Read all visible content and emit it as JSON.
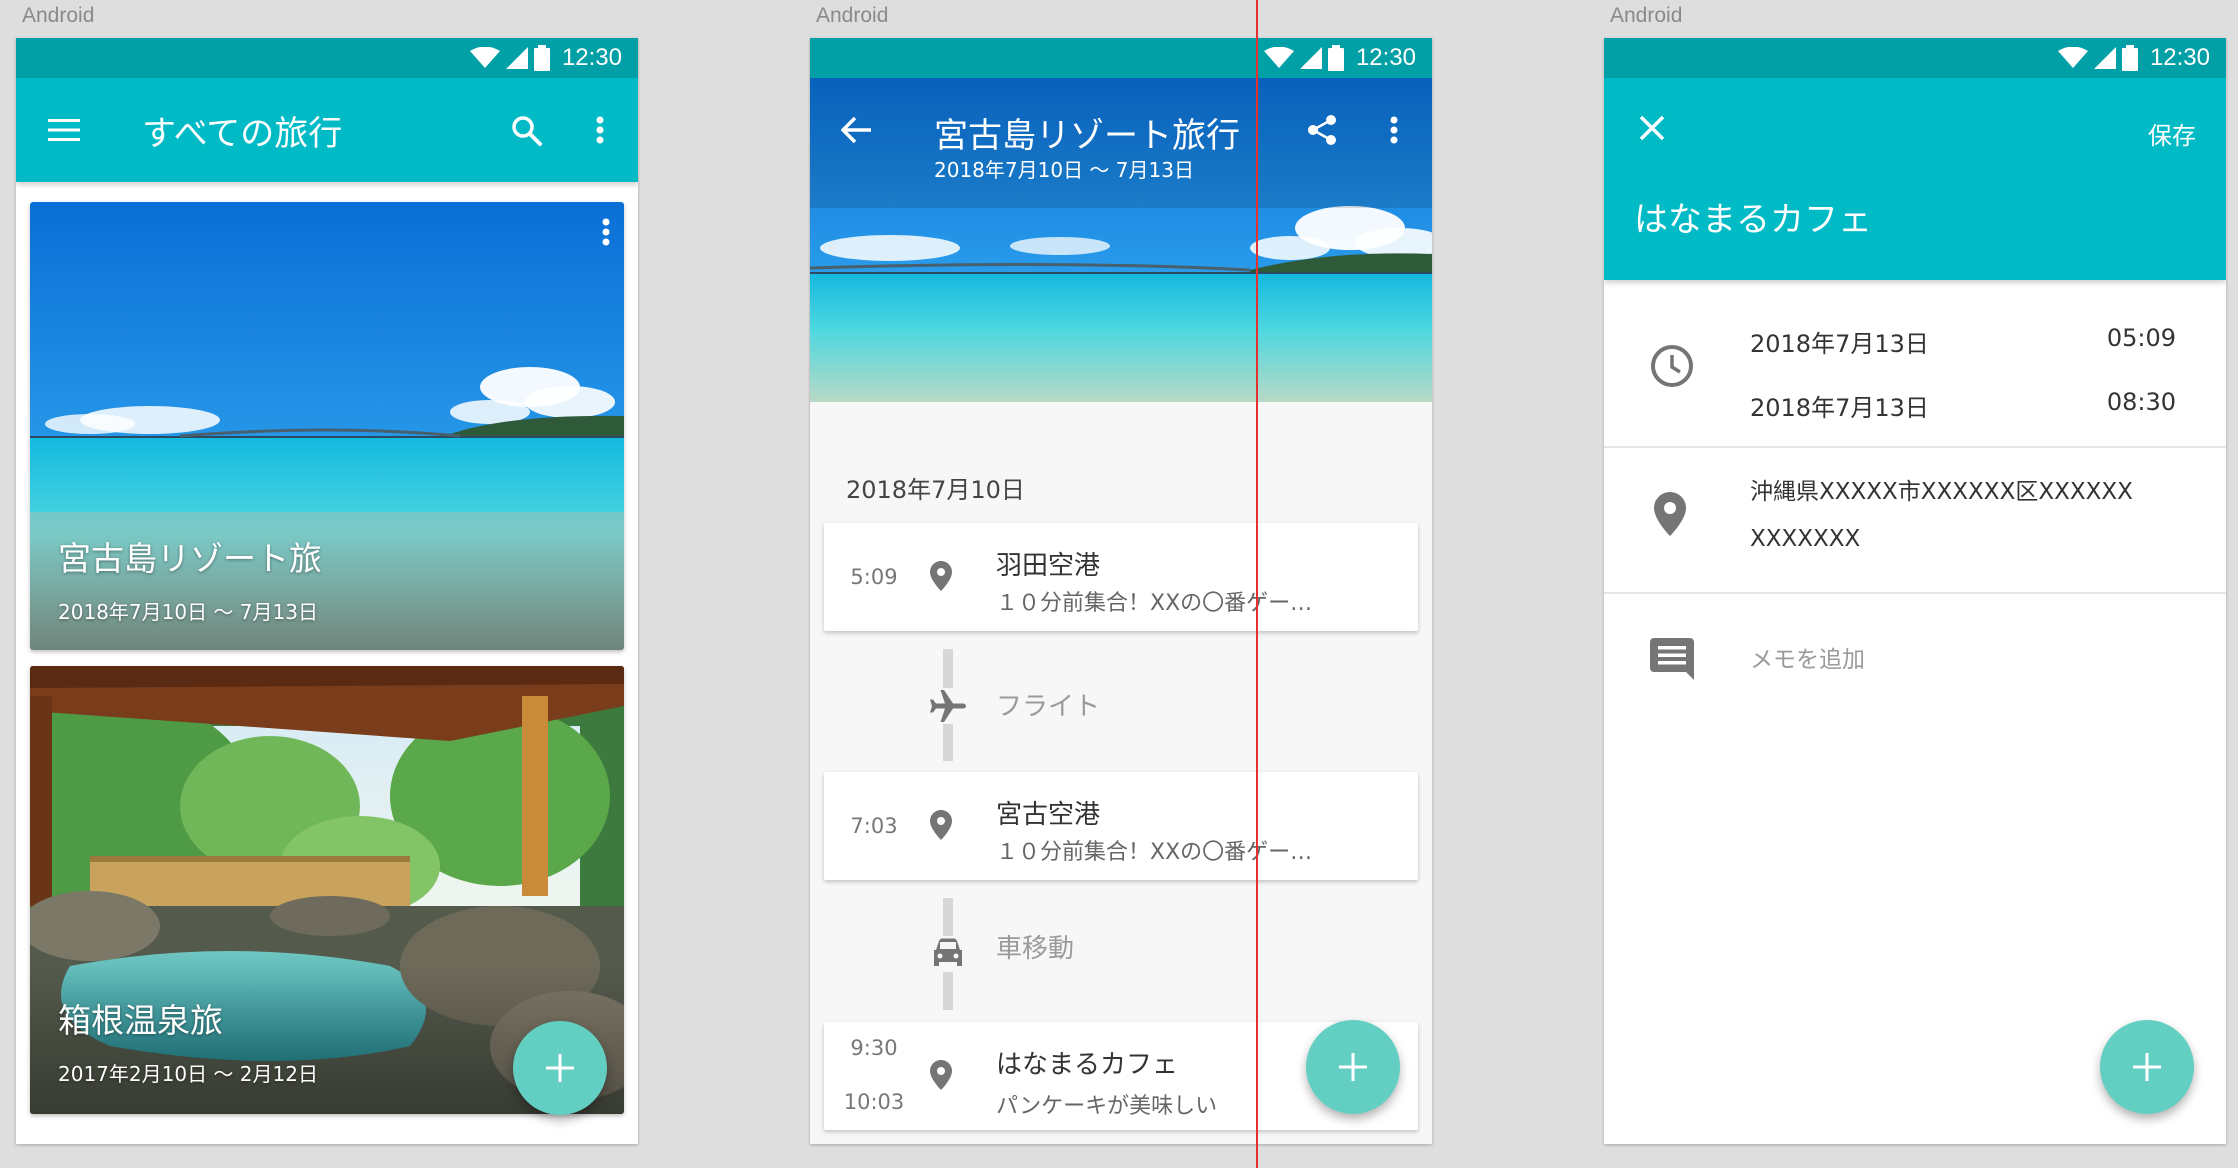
{
  "device_label": "Android",
  "status_time": "12:30",
  "colors": {
    "status": "#00a0a6",
    "appbar": "#00bac6",
    "fab": "#63cfc2",
    "guide": "#e53030"
  },
  "screen1": {
    "title": "すべての旅行",
    "trips": [
      {
        "title": "宮古島リゾート旅",
        "dates": "2018年7月10日 ～ 7月13日"
      },
      {
        "title": "箱根温泉旅",
        "dates": "2017年2月10日 ～ 2月12日"
      }
    ]
  },
  "screen2": {
    "title": "宮古島リゾート旅行",
    "dates": "2018年7月10日 ～ 7月13日",
    "day_header": "2018年7月10日",
    "events": [
      {
        "time": "5:09",
        "title": "羽田空港",
        "desc": "１０分前集合！XXの〇番ゲー…"
      },
      {
        "time": "7:03",
        "title": "宮古空港",
        "desc": "１０分前集合！XXの〇番ゲー…"
      },
      {
        "time_start": "9:30",
        "time_end": "10:03",
        "title": "はなまるカフェ",
        "desc": "パンケーキが美味しい"
      }
    ],
    "transits": [
      {
        "label": "フライト",
        "icon": "airplane-icon"
      },
      {
        "label": "車移動",
        "icon": "car-icon"
      }
    ]
  },
  "screen3": {
    "save_label": "保存",
    "title": "はなまるカフェ",
    "start_date": "2018年7月13日",
    "start_time": "05:09",
    "end_date": "2018年7月13日",
    "end_time": "08:30",
    "address_line1": "沖縄県XXXXX市XXXXXX区XXXXXX",
    "address_line2": "XXXXXXX",
    "memo_placeholder": "メモを追加"
  }
}
